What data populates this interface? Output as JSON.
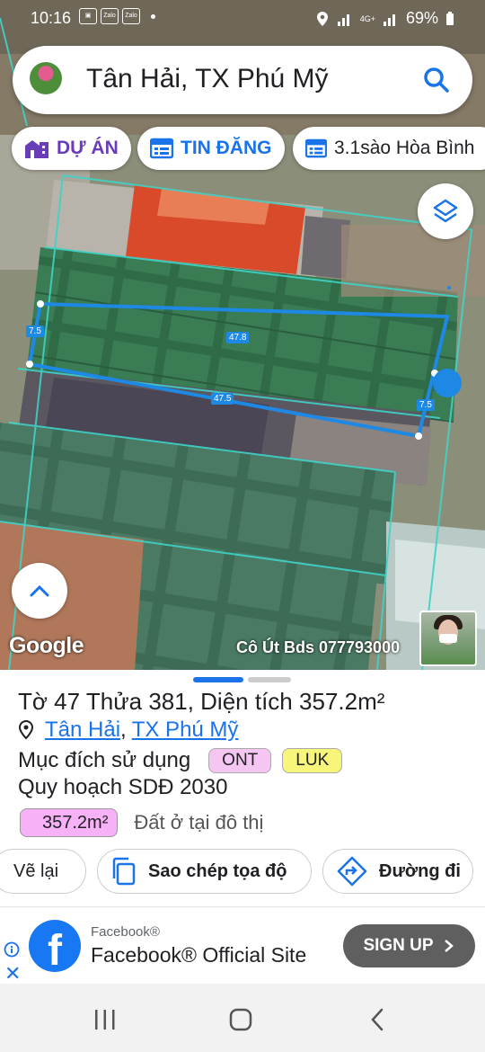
{
  "status_bar": {
    "time": "10:16",
    "notification_icons": [
      "gallery-icon",
      "zalo-icon",
      "zalo-icon"
    ],
    "zalo_label": "Zalo",
    "network": "4G+",
    "battery": "69%"
  },
  "search": {
    "query": "Tân Hải, TX Phú Mỹ"
  },
  "chips": {
    "project": "DỰ ÁN",
    "listing": "TIN ĐĂNG",
    "place": "3.1sào Hòa Bình"
  },
  "map": {
    "measurements": [
      "7.5",
      "47.8",
      "47.5",
      "7.5"
    ],
    "google_label": "Google",
    "attribution": "Cô Út Bds 077793000",
    "colors": {
      "boundary": "#1e88e5",
      "parcel_line": "#2ec4b6"
    }
  },
  "parcel": {
    "sheet_label": "Tờ",
    "sheet_no": "47",
    "plot_label": "Thửa",
    "plot_no": "381",
    "area_label": "Diện tích",
    "area": "357.2m²",
    "location_ward": "Tân Hải",
    "location_sep": ",",
    "location_town": "TX Phú Mỹ",
    "usage_label": "Mục đích sử dụng",
    "usage_codes": [
      "ONT",
      "LUK"
    ],
    "planning_label": "Quy hoạch SDĐ 2030",
    "planning_area": "357.2m²",
    "planning_desc": "Đất ở tại đô thị"
  },
  "actions": {
    "redo": "Vẽ lại",
    "copy": "Sao chép tọa độ",
    "directions": "Đường đi"
  },
  "ad": {
    "small": "Facebook®",
    "big": "Facebook® Official Site",
    "cta": "SIGN UP",
    "close": "✕"
  }
}
